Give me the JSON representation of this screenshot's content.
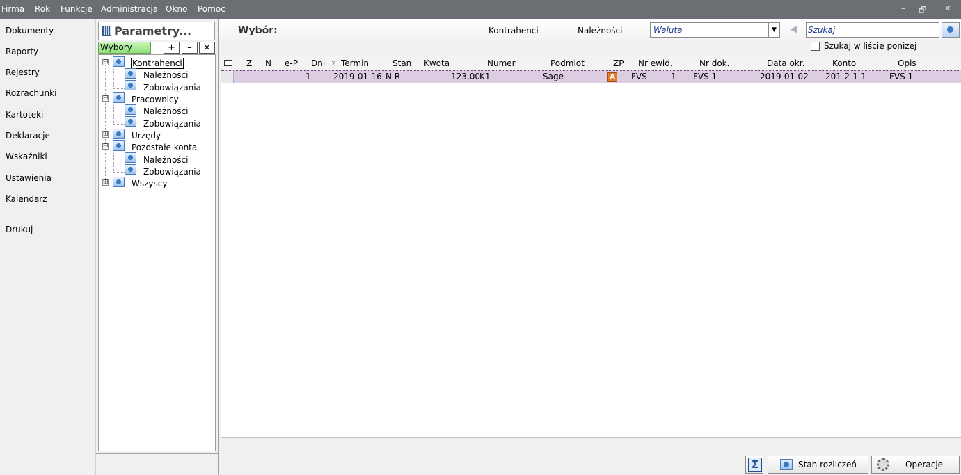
{
  "menu": {
    "items": [
      "Firma",
      "Rok",
      "Funkcje",
      "Administracja",
      "Okno",
      "Pomoc"
    ],
    "window_buttons": [
      "–",
      "🗗",
      "✕"
    ]
  },
  "leftnav": {
    "items": [
      "Dokumenty",
      "Raporty",
      "Rejestry",
      "Rozrachunki",
      "Kartoteki",
      "Deklaracje",
      "Wskaźniki",
      "Ustawienia",
      "Kalendarz"
    ],
    "extra": "Drukuj"
  },
  "params": {
    "title": "Parametry...",
    "wybory_label": "Wybory",
    "buttons": [
      "+",
      "–",
      "×"
    ],
    "tree": [
      {
        "label": "Kontrahenci",
        "level": 0,
        "expander": "⊟",
        "selected": true
      },
      {
        "label": "Należności",
        "level": 1
      },
      {
        "label": "Zobowiązania",
        "level": 1
      },
      {
        "label": "Pracownicy",
        "level": 0,
        "expander": "⊟"
      },
      {
        "label": "Należności",
        "level": 1
      },
      {
        "label": "Zobowiązania",
        "level": 1
      },
      {
        "label": "Urzędy",
        "level": 0,
        "expander": "⊞"
      },
      {
        "label": "Pozostałe konta",
        "level": 0,
        "expander": "⊟"
      },
      {
        "label": "Należności",
        "level": 1
      },
      {
        "label": "Zobowiązania",
        "level": 1
      },
      {
        "label": "Wszyscy",
        "level": 0,
        "expander": "⊞"
      }
    ]
  },
  "toolbar": {
    "title": "Wybór:",
    "kontrahenci": "Kontrahenci",
    "naleznosci": "Należności",
    "waluta_placeholder": "Waluta",
    "search_placeholder": "Szukaj",
    "search_in_list": "Szukaj w liście poniżej"
  },
  "grid": {
    "columns": [
      "Z",
      "N",
      "e-P",
      "Dni",
      "Termin",
      "Stan",
      "Kwota",
      "Numer",
      "Podmiot",
      "ZP",
      "Nr ewid.",
      "Nr dok.",
      "Data okr.",
      "Konto",
      "Opis"
    ],
    "sort_indicator": "▿",
    "rows": [
      {
        "dni": "1",
        "termin": "2019-01-16",
        "stan": "N R",
        "kwota": "123,00",
        "numer": "K1",
        "podmiot": "Sage",
        "zp": "A",
        "nr_ewid_prefix": "FVS",
        "nr_ewid_num": "1",
        "nr_dok": "FVS 1",
        "data_okr": "2019-01-02",
        "konto": "201-2-1-1",
        "opis": "FVS 1"
      }
    ]
  },
  "buttons": {
    "stan_rozliczen": "Stan rozliczeń",
    "operacje": "Operacje"
  }
}
